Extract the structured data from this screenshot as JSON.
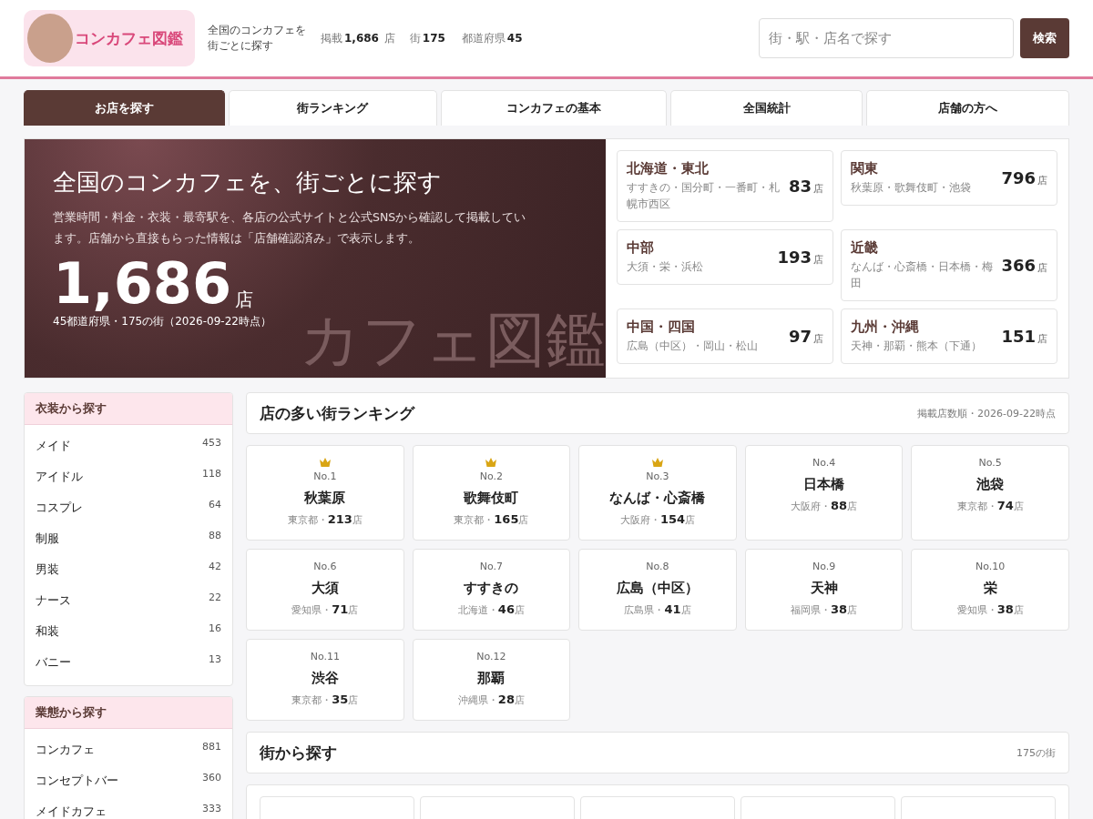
{
  "header": {
    "logo_text": "コンカフェ図鑑",
    "tagline": "全国のコンカフェを街ごとに探す",
    "stats": [
      {
        "label": "掲載",
        "value": "1,686",
        "unit": "店"
      },
      {
        "label": "街",
        "value": "175"
      },
      {
        "label": "都道府県",
        "value": "45"
      }
    ],
    "search": {
      "placeholder": "街・駅・店名で探す",
      "button": "検索"
    }
  },
  "tabs": [
    {
      "label": "お店を探す",
      "selected": true
    },
    {
      "label": "街ランキング",
      "selected": false
    },
    {
      "label": "コンカフェの基本",
      "selected": false
    },
    {
      "label": "全国統計",
      "selected": false
    },
    {
      "label": "店舗の方へ",
      "selected": false
    }
  ],
  "hero": {
    "title": "全国のコンカフェを、街ごとに探す",
    "description": "営業時間・料金・衣装・最寄駅を、各店の公式サイトと公式SNSから確認して掲載しています。店舗から直接もらった情報は「店舗確認済み」で表示します。",
    "count": "1,686",
    "count_unit": "店",
    "note": "45都道府県・175の街（2026-09-22時点）",
    "backdrop_text": "カフェ図鑑"
  },
  "regions": [
    {
      "name": "北海道・東北",
      "areas": "すすきの・国分町・一番町・札幌市西区",
      "count": "83",
      "unit": "店"
    },
    {
      "name": "関東",
      "areas": "秋葉原・歌舞伎町・池袋",
      "count": "796",
      "unit": "店"
    },
    {
      "name": "中部",
      "areas": "大須・栄・浜松",
      "count": "193",
      "unit": "店"
    },
    {
      "name": "近畿",
      "areas": "なんば・心斎橋・日本橋・梅田",
      "count": "366",
      "unit": "店"
    },
    {
      "name": "中国・四国",
      "areas": "広島（中区）・岡山・松山",
      "count": "97",
      "unit": "店"
    },
    {
      "name": "九州・沖縄",
      "areas": "天神・那覇・熊本（下通）",
      "count": "151",
      "unit": "店"
    }
  ],
  "sidebar": [
    {
      "title": "衣装から探す",
      "items": [
        {
          "label": "メイド",
          "count": "453"
        },
        {
          "label": "アイドル",
          "count": "118"
        },
        {
          "label": "コスプレ",
          "count": "64"
        },
        {
          "label": "制服",
          "count": "88"
        },
        {
          "label": "男装",
          "count": "42"
        },
        {
          "label": "ナース",
          "count": "22"
        },
        {
          "label": "和装",
          "count": "16"
        },
        {
          "label": "バニー",
          "count": "13"
        }
      ]
    },
    {
      "title": "業態から探す",
      "items": [
        {
          "label": "コンカフェ",
          "count": "881"
        },
        {
          "label": "コンセプトバー",
          "count": "360"
        },
        {
          "label": "メイドカフェ",
          "count": "333"
        }
      ]
    }
  ],
  "ranking": {
    "title": "店の多い街ランキング",
    "note": "掲載店数順・2026-09-22時点",
    "items": [
      {
        "rank": "No.1",
        "crown": true,
        "town": "秋葉原",
        "pref": "東京都・",
        "count": "213",
        "unit": "店"
      },
      {
        "rank": "No.2",
        "crown": true,
        "town": "歌舞伎町",
        "pref": "東京都・",
        "count": "165",
        "unit": "店"
      },
      {
        "rank": "No.3",
        "crown": true,
        "town": "なんば・心斎橋",
        "pref": "大阪府・",
        "count": "154",
        "unit": "店"
      },
      {
        "rank": "No.4",
        "crown": false,
        "town": "日本橋",
        "pref": "大阪府・",
        "count": "88",
        "unit": "店"
      },
      {
        "rank": "No.5",
        "crown": false,
        "town": "池袋",
        "pref": "東京都・",
        "count": "74",
        "unit": "店"
      },
      {
        "rank": "No.6",
        "crown": false,
        "town": "大須",
        "pref": "愛知県・",
        "count": "71",
        "unit": "店"
      },
      {
        "rank": "No.7",
        "crown": false,
        "town": "すすきの",
        "pref": "北海道・",
        "count": "46",
        "unit": "店"
      },
      {
        "rank": "No.8",
        "crown": false,
        "town": "広島（中区）",
        "pref": "広島県・",
        "count": "41",
        "unit": "店"
      },
      {
        "rank": "No.9",
        "crown": false,
        "town": "天神",
        "pref": "福岡県・",
        "count": "38",
        "unit": "店"
      },
      {
        "rank": "No.10",
        "crown": false,
        "town": "栄",
        "pref": "愛知県・",
        "count": "38",
        "unit": "店"
      },
      {
        "rank": "No.11",
        "crown": false,
        "town": "渋谷",
        "pref": "東京都・",
        "count": "35",
        "unit": "店"
      },
      {
        "rank": "No.12",
        "crown": false,
        "town": "那覇",
        "pref": "沖縄県・",
        "count": "28",
        "unit": "店"
      }
    ]
  },
  "towns": {
    "title": "街から探す",
    "note": "175の街"
  }
}
